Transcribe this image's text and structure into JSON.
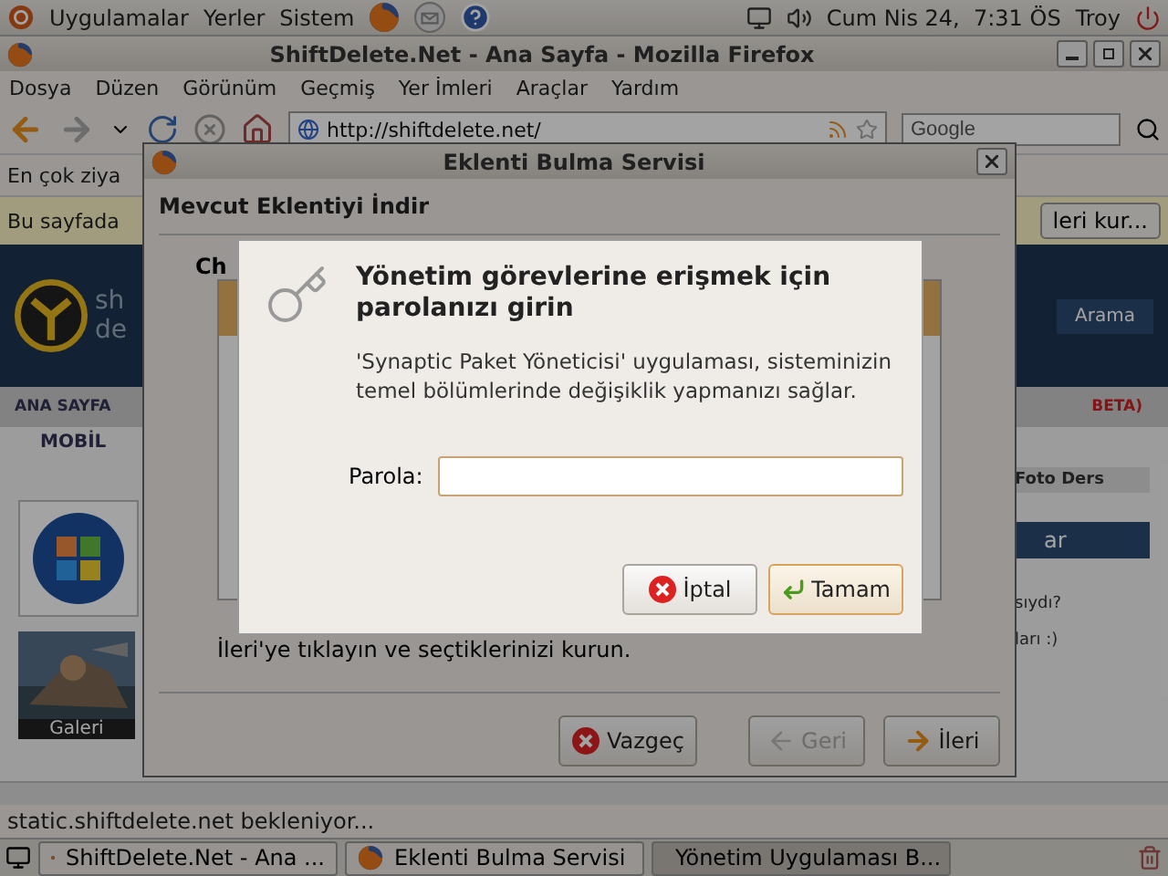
{
  "top_panel": {
    "menus": [
      "Uygulamalar",
      "Yerler",
      "Sistem"
    ],
    "clock": "Cum Nis 24,  7:31 ÖS",
    "user": "Troy"
  },
  "browser": {
    "title": "ShiftDelete.Net - Ana Sayfa - Mozilla Firefox",
    "menu": [
      "Dosya",
      "Düzen",
      "Görünüm",
      "Geçmiş",
      "Yer İmleri",
      "Araçlar",
      "Yardım"
    ],
    "url": "http://shiftdelete.net/",
    "search": {
      "placeholder": "Google"
    },
    "bookmarks": [
      "En çok ziya"
    ],
    "notification": {
      "text": "Bu sayfada",
      "button": "leri kur..."
    },
    "page": {
      "logo": [
        "sh",
        "de"
      ],
      "search_button": "Arama",
      "nav": [
        "ANA SAYFA",
        "BETA)"
      ],
      "subnav": [
        "MOBİL"
      ],
      "sidebar": [
        "Foto Ders",
        "ar",
        "sıydı?",
        "ları :)"
      ],
      "gallery_caption": "Galeri"
    },
    "status": "static.shiftdelete.net bekleniyor..."
  },
  "plugin_dialog": {
    "title": "Eklenti Bulma Servisi",
    "heading": "Mevcut Eklentiyi İndir",
    "subheading": "Ch",
    "instruction": "İleri'ye tıklayın ve seçtiklerinizi kurun.",
    "buttons": [
      {
        "kind": "cancel",
        "label": "Vazgeç",
        "disabled": false
      },
      {
        "kind": "back",
        "label": "Geri",
        "disabled": true
      },
      {
        "kind": "next",
        "label": "İleri",
        "disabled": false
      }
    ]
  },
  "auth_dialog": {
    "title": "Yönetim görevlerine erişmek için parolanızı girin",
    "message": "'Synaptic Paket Yöneticisi' uygulaması, sisteminizin temel bölümlerinde değişiklik yapmanızı sağlar.",
    "field_label": "Parola:",
    "buttons": [
      {
        "kind": "cancel",
        "label": "İptal",
        "default": false
      },
      {
        "kind": "ok",
        "label": "Tamam",
        "default": true
      }
    ]
  },
  "taskbar": [
    {
      "label": "ShiftDelete.Net - Ana ...",
      "kind": "firefox",
      "selected": false
    },
    {
      "label": "Eklenti Bulma Servisi",
      "kind": "firefox",
      "selected": false
    },
    {
      "label": "Yönetim Uygulaması B...",
      "kind": "gear",
      "selected": true
    }
  ]
}
